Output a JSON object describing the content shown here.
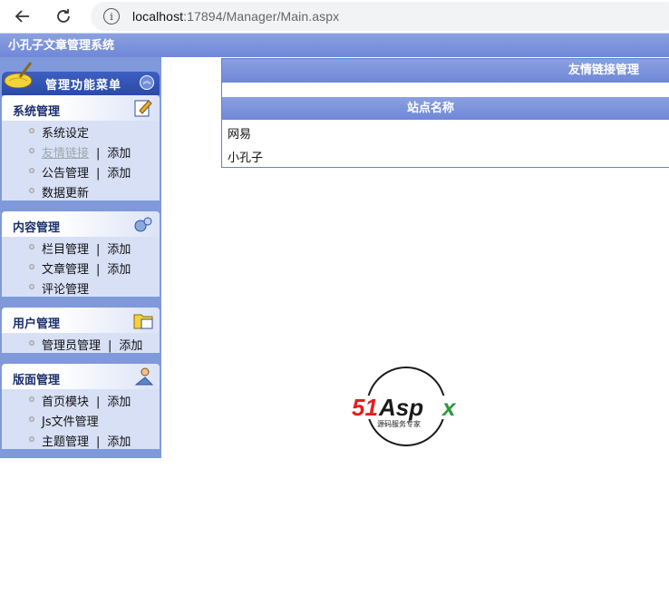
{
  "browser": {
    "url_host": "localhost",
    "url_rest": ":17894/Manager/Main.aspx"
  },
  "app": {
    "title": "小孔子文章管理系统"
  },
  "menu": {
    "header": "管理功能菜单",
    "sections": [
      {
        "title": "系统管理",
        "items": [
          {
            "label": "系统设定"
          },
          {
            "label": "友情链接",
            "extra": "添加",
            "muted": true
          },
          {
            "label": "公告管理",
            "extra": "添加"
          },
          {
            "label": "数据更新"
          }
        ]
      },
      {
        "title": "内容管理",
        "items": [
          {
            "label": "栏目管理",
            "extra": "添加"
          },
          {
            "label": "文章管理",
            "extra": "添加"
          },
          {
            "label": "评论管理"
          }
        ]
      },
      {
        "title": "用户管理",
        "items": [
          {
            "label": "管理员管理",
            "extra": "添加"
          }
        ]
      },
      {
        "title": "版面管理",
        "items": [
          {
            "label": "首页模块",
            "extra": "添加"
          },
          {
            "label": "Js文件管理"
          },
          {
            "label": "主题管理",
            "extra": "添加"
          }
        ]
      }
    ],
    "separator": "|"
  },
  "main": {
    "panel_title": "友情链接管理",
    "column_header": "站点名称",
    "rows": [
      "网易",
      "小孔子"
    ]
  },
  "logo": {
    "brand": "51Aspx",
    "tagline": "源码服务专家"
  }
}
